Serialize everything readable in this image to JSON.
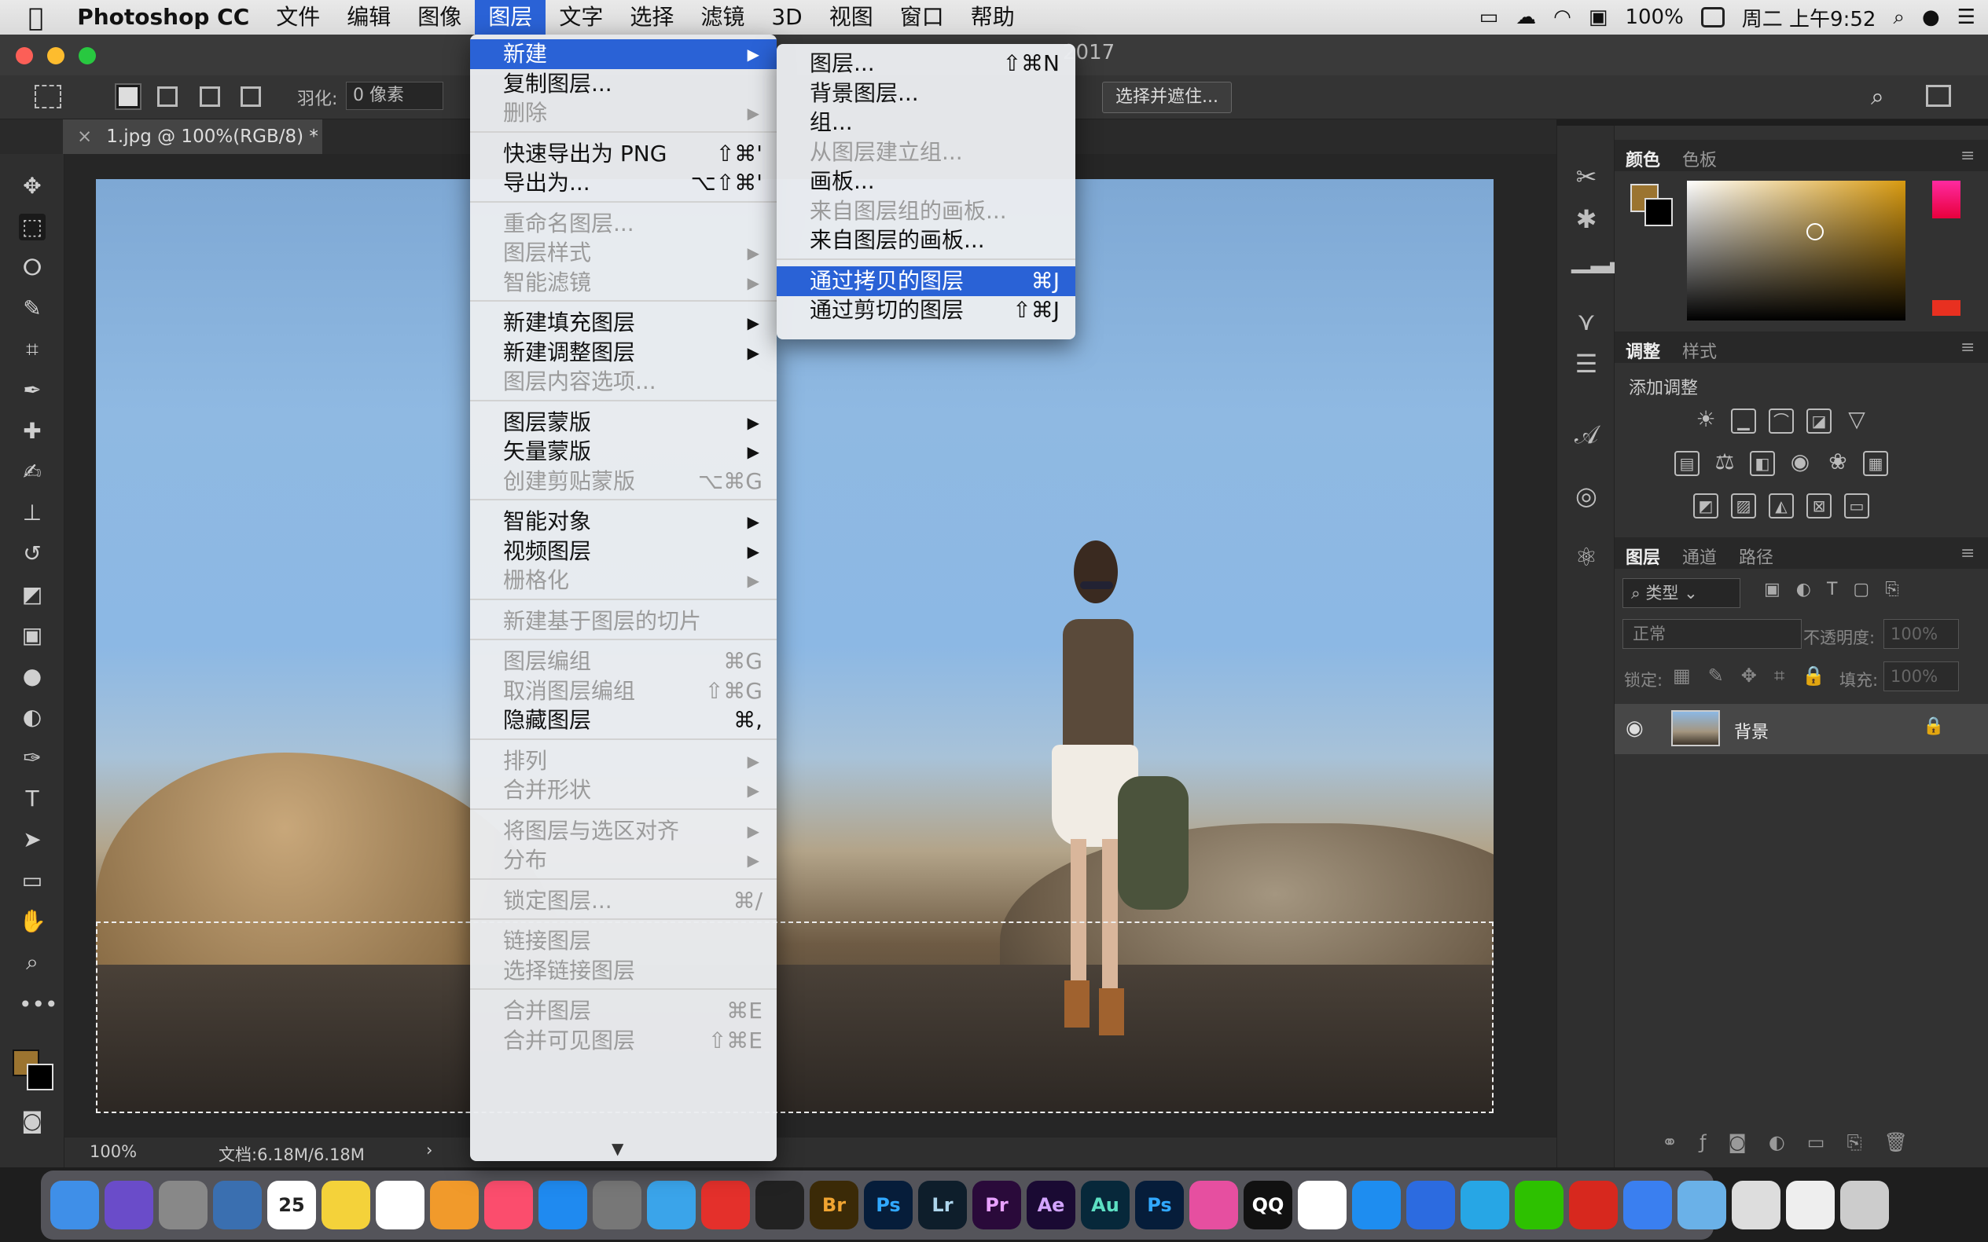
{
  "menubar": {
    "app": "Photoshop CC",
    "items": [
      "文件",
      "编辑",
      "图像",
      "图层",
      "文字",
      "选择",
      "滤镜",
      "3D",
      "视图",
      "窗口",
      "帮助"
    ],
    "active_index": 3,
    "battery": "100%",
    "clock": "周二 上午9:52"
  },
  "window": {
    "title_fragment": "2017",
    "document_tab": "1.jpg @ 100%(RGB/8) *"
  },
  "options": {
    "feather_label": "羽化:",
    "feather_value": "0 像素",
    "select_mask_btn": "选择并遮住..."
  },
  "status": {
    "zoom": "100%",
    "doc_size": "文档:6.18M/6.18M"
  },
  "layer_menu": {
    "items": [
      {
        "label": "新建",
        "sc": "",
        "sub": true,
        "state": "hl"
      },
      {
        "label": "复制图层...",
        "sc": "",
        "sub": false,
        "state": ""
      },
      {
        "label": "删除",
        "sc": "",
        "sub": true,
        "state": "dis"
      },
      {
        "sep": true
      },
      {
        "label": "快速导出为 PNG",
        "sc": "⇧⌘'",
        "sub": false,
        "state": ""
      },
      {
        "label": "导出为...",
        "sc": "⌥⇧⌘'",
        "sub": false,
        "state": ""
      },
      {
        "sep": true
      },
      {
        "label": "重命名图层...",
        "sc": "",
        "sub": false,
        "state": "dis"
      },
      {
        "label": "图层样式",
        "sc": "",
        "sub": true,
        "state": "dis"
      },
      {
        "label": "智能滤镜",
        "sc": "",
        "sub": true,
        "state": "dis"
      },
      {
        "sep": true
      },
      {
        "label": "新建填充图层",
        "sc": "",
        "sub": true,
        "state": ""
      },
      {
        "label": "新建调整图层",
        "sc": "",
        "sub": true,
        "state": ""
      },
      {
        "label": "图层内容选项...",
        "sc": "",
        "sub": false,
        "state": "dis"
      },
      {
        "sep": true
      },
      {
        "label": "图层蒙版",
        "sc": "",
        "sub": true,
        "state": ""
      },
      {
        "label": "矢量蒙版",
        "sc": "",
        "sub": true,
        "state": ""
      },
      {
        "label": "创建剪贴蒙版",
        "sc": "⌥⌘G",
        "sub": false,
        "state": "dis"
      },
      {
        "sep": true
      },
      {
        "label": "智能对象",
        "sc": "",
        "sub": true,
        "state": ""
      },
      {
        "label": "视频图层",
        "sc": "",
        "sub": true,
        "state": ""
      },
      {
        "label": "栅格化",
        "sc": "",
        "sub": true,
        "state": "dis"
      },
      {
        "sep": true
      },
      {
        "label": "新建基于图层的切片",
        "sc": "",
        "sub": false,
        "state": "dis"
      },
      {
        "sep": true
      },
      {
        "label": "图层编组",
        "sc": "⌘G",
        "sub": false,
        "state": "dis"
      },
      {
        "label": "取消图层编组",
        "sc": "⇧⌘G",
        "sub": false,
        "state": "dis"
      },
      {
        "label": "隐藏图层",
        "sc": "⌘,",
        "sub": false,
        "state": ""
      },
      {
        "sep": true
      },
      {
        "label": "排列",
        "sc": "",
        "sub": true,
        "state": "dis"
      },
      {
        "label": "合并形状",
        "sc": "",
        "sub": true,
        "state": "dis"
      },
      {
        "sep": true
      },
      {
        "label": "将图层与选区对齐",
        "sc": "",
        "sub": true,
        "state": "dis"
      },
      {
        "label": "分布",
        "sc": "",
        "sub": true,
        "state": "dis"
      },
      {
        "sep": true
      },
      {
        "label": "锁定图层...",
        "sc": "⌘/",
        "sub": false,
        "state": "dis"
      },
      {
        "sep": true
      },
      {
        "label": "链接图层",
        "sc": "",
        "sub": false,
        "state": "dis"
      },
      {
        "label": "选择链接图层",
        "sc": "",
        "sub": false,
        "state": "dis"
      },
      {
        "sep": true
      },
      {
        "label": "合并图层",
        "sc": "⌘E",
        "sub": false,
        "state": "dis"
      },
      {
        "label": "合并可见图层",
        "sc": "⇧⌘E",
        "sub": false,
        "state": "dis"
      }
    ]
  },
  "new_submenu": {
    "items": [
      {
        "label": "图层...",
        "sc": "⇧⌘N",
        "state": ""
      },
      {
        "label": "背景图层...",
        "sc": "",
        "state": ""
      },
      {
        "label": "组...",
        "sc": "",
        "state": ""
      },
      {
        "label": "从图层建立组...",
        "sc": "",
        "state": "dis"
      },
      {
        "label": "画板...",
        "sc": "",
        "state": ""
      },
      {
        "label": "来自图层组的画板...",
        "sc": "",
        "state": "dis"
      },
      {
        "label": "来自图层的画板...",
        "sc": "",
        "state": ""
      },
      {
        "sep": true
      },
      {
        "label": "通过拷贝的图层",
        "sc": "⌘J",
        "state": "hl"
      },
      {
        "label": "通过剪切的图层",
        "sc": "⇧⌘J",
        "state": ""
      }
    ]
  },
  "panels": {
    "color_tabs": [
      "颜色",
      "色板"
    ],
    "adjust_tabs": [
      "调整",
      "样式"
    ],
    "adjust_title": "添加调整",
    "layers_tabs": [
      "图层",
      "通道",
      "路径"
    ],
    "kind_filter": "类型",
    "blend_mode": "正常",
    "opacity_label": "不透明度:",
    "opacity_value": "100%",
    "lock_label": "锁定:",
    "fill_label": "填充:",
    "fill_value": "100%",
    "layer_name": "背景"
  },
  "colors": {
    "foreground": "#9b7430",
    "accent": "#2a62d6"
  },
  "dock": [
    "Finder",
    "Siri",
    "Launchpad",
    "Preview",
    "Calendar",
    "Notes",
    "Reminders",
    "Photos",
    "Music",
    "App Store",
    "System Preferences",
    "QQ Browser",
    "Weibo",
    "Final Cut",
    "Br",
    "Ps",
    "Lr",
    "Pr",
    "Ae",
    "Au",
    "Ps",
    "Keynote",
    "QQ",
    "Chrome",
    "Safari",
    "Baidu",
    "Telegram",
    "WeChat",
    "Youdao",
    "Keynote2",
    "Folder",
    "Screenshots",
    "Images",
    "Trash"
  ],
  "calendar_day": "25"
}
